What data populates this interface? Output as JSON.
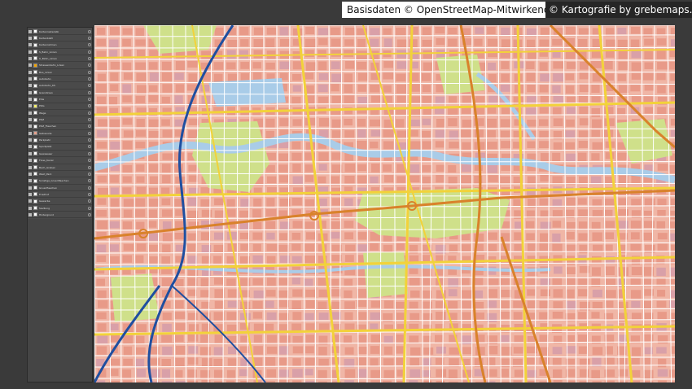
{
  "credits": {
    "osm": "Basisdaten © OpenStreetMap-Mitwirkende",
    "cartography": "© Kartografie by grebemaps.de"
  },
  "layers_panel": {
    "layers": [
      {
        "name": "Kartenrasterabk",
        "swatch": "#ffffff"
      },
      {
        "name": "Kartenblatt",
        "swatch": "#ffffff"
      },
      {
        "name": "Kartenrahmen",
        "swatch": "#ffffff"
      },
      {
        "name": "S_Bahn_Linien",
        "swatch": "#ffffff"
      },
      {
        "name": "U_Bahn_Linien",
        "swatch": "#ffffff"
      },
      {
        "name": "Strassenbahn_Linien",
        "swatch": "#f4a300"
      },
      {
        "name": "Bus_Linien",
        "swatch": "#ffffff"
      },
      {
        "name": "Autobahn",
        "swatch": "#ffffff"
      },
      {
        "name": "Autobahn_KS",
        "swatch": "#ffffff"
      },
      {
        "name": "Grenzlinien",
        "swatch": "#ffffff"
      },
      {
        "name": "Ellie",
        "swatch": "#ffffff"
      },
      {
        "name": "POIs",
        "swatch": "#f5f06a"
      },
      {
        "name": "Wege",
        "swatch": "#ffffff"
      },
      {
        "name": "POZ",
        "swatch": "#ffffff"
      },
      {
        "name": "POZ_Flaechen",
        "swatch": "#ffffff"
      },
      {
        "name": "Gebaeude",
        "swatch": "#e6a08c"
      },
      {
        "name": "Parkplatz",
        "swatch": "#ffffff"
      },
      {
        "name": "Sportplatz",
        "swatch": "#ffffff"
      },
      {
        "name": "Gewaesser",
        "swatch": "#ffffff"
      },
      {
        "name": "Fluss_Kanal",
        "swatch": "#ffffff"
      },
      {
        "name": "Bach_Graben",
        "swatch": "#ffffff"
      },
      {
        "name": "Wald_Park",
        "swatch": "#ffffff"
      },
      {
        "name": "Sonstige_Gruenflaechen",
        "swatch": "#ffffff"
      },
      {
        "name": "Gruenflaechen",
        "swatch": "#ffffff"
      },
      {
        "name": "Friedhof",
        "swatch": "#ffffff"
      },
      {
        "name": "Gewerbe",
        "swatch": "#ffffff"
      },
      {
        "name": "Siedlung",
        "swatch": "#ffffff"
      },
      {
        "name": "Hintergrund",
        "swatch": "#ffffff"
      }
    ]
  },
  "map_colors": {
    "background": "#f0b6a6",
    "building": "#e89a88",
    "park": "#cfe08a",
    "water": "#a9cce8",
    "main_road": "#f2d23a",
    "arterial": "#d9822b",
    "motorway": "#1f4fa0",
    "street": "#ffffff"
  }
}
